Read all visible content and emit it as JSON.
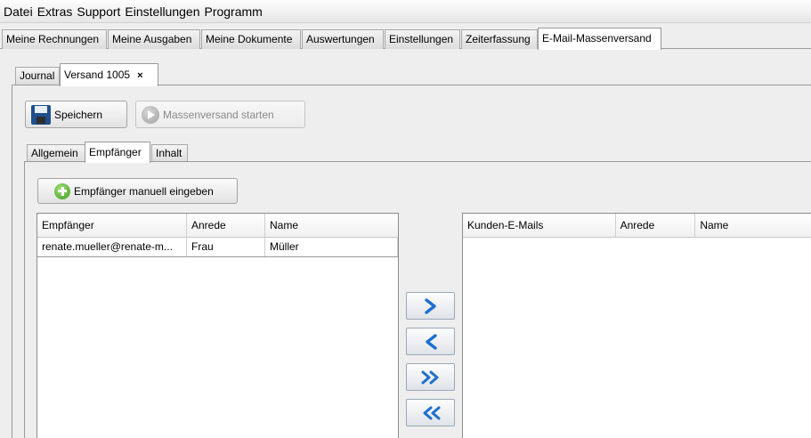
{
  "menu": [
    "Datei",
    "Extras",
    "Support",
    "Einstellungen",
    "Programm"
  ],
  "main_tabs": [
    "Meine Rechnungen",
    "Meine Ausgaben",
    "Meine Dokumente",
    "Auswertungen",
    "Einstellungen",
    "Zeiterfassung",
    "E-Mail-Massenversand"
  ],
  "sub_tabs": {
    "journal": "Journal",
    "versand": "Versand 1005",
    "close": "×"
  },
  "toolbar": {
    "save_label": "Speichern",
    "start_label": "Massenversand starten"
  },
  "detail_tabs": [
    "Allgemein",
    "Empfänger",
    "Inhalt"
  ],
  "add_recipient_label": "Empfänger manuell eingeben",
  "recipients_table": {
    "columns": [
      "Empfänger",
      "Anrede",
      "Name"
    ],
    "rows": [
      [
        "renate.mueller@renate-m...",
        "Frau",
        "Müller"
      ]
    ]
  },
  "customers_table": {
    "columns": [
      "Kunden-E-Mails",
      "Anrede",
      "Name"
    ]
  },
  "colors": {
    "arrow_blue": "#1e6fd0",
    "tab_border": "#9a9a9a"
  },
  "icons": [
    "save-icon",
    "play-arrow-icon",
    "add-plus-icon",
    "arrow-right-icon",
    "arrow-left-icon",
    "double-arrow-right-icon",
    "double-arrow-left-icon"
  ]
}
